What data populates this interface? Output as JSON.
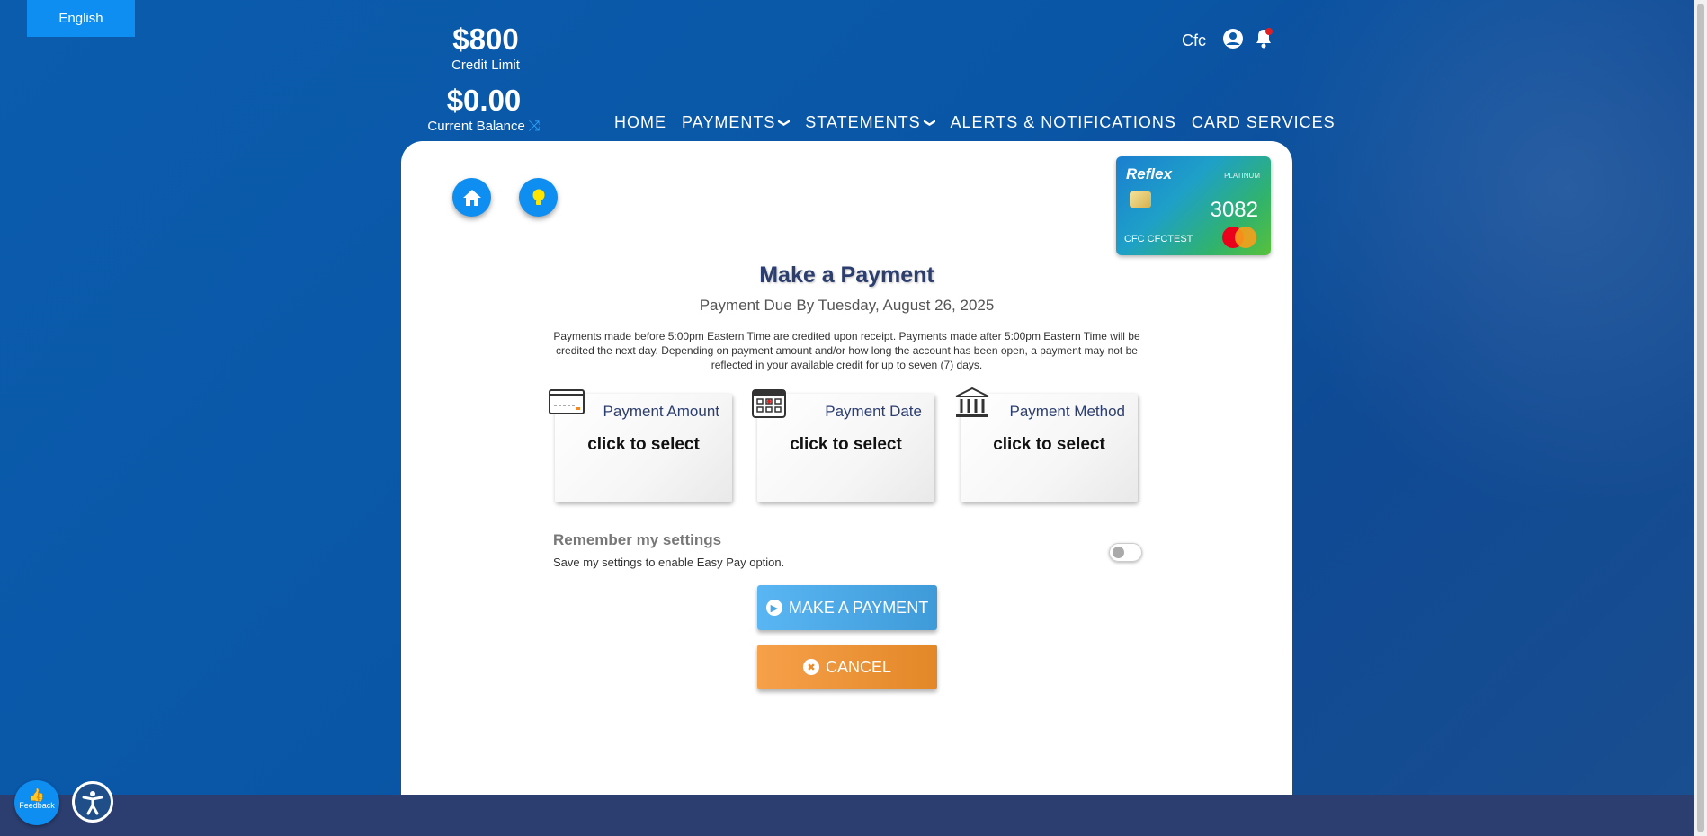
{
  "language": {
    "label": "English"
  },
  "account": {
    "credit_limit_value": "$800",
    "credit_limit_label": "Credit Limit",
    "current_balance_value": "$0.00",
    "current_balance_label": "Current Balance"
  },
  "user": {
    "name": "Cfc"
  },
  "nav": {
    "home": "HOME",
    "payments": "PAYMENTS",
    "statements": "STATEMENTS",
    "alerts": "ALERTS & NOTIFICATIONS",
    "card_services": "CARD SERVICES"
  },
  "card": {
    "brand": "Reflex",
    "tier": "PLATINUM",
    "last4": "3082",
    "holder": "CFC CFCTEST"
  },
  "page": {
    "title": "Make a Payment",
    "due": "Payment Due By Tuesday, August 26, 2025",
    "disclaimer": "Payments made before 5:00pm Eastern Time are credited upon receipt. Payments made after 5:00pm Eastern Time will be credited the next day. Depending on payment amount and/or how long the account has been open, a payment may not be reflected in your available credit for up to seven (7) days."
  },
  "selectors": {
    "amount": {
      "label": "Payment Amount",
      "value": "click to select"
    },
    "date": {
      "label": "Payment Date",
      "value": "click to select"
    },
    "method": {
      "label": "Payment Method",
      "value": "click to select"
    }
  },
  "remember": {
    "title": "Remember my settings",
    "subtitle": "Save my settings to enable Easy Pay option.",
    "enabled": false
  },
  "buttons": {
    "pay": "MAKE A PAYMENT",
    "cancel": "CANCEL"
  },
  "feedback": {
    "label": "Feedback"
  },
  "colors": {
    "primary_blue": "#0d8ef0",
    "navy": "#2c3e6f",
    "pay_button": "#4aa6e4",
    "cancel_button": "#e98c2e"
  }
}
